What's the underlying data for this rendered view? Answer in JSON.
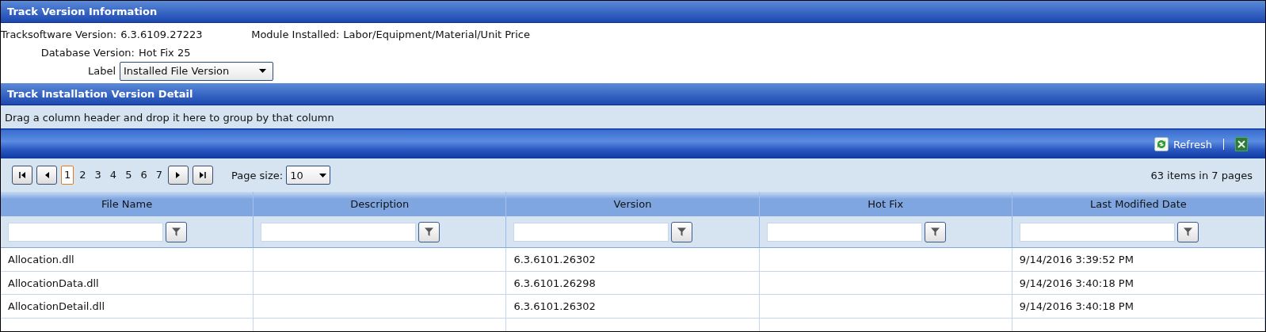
{
  "info_panel": {
    "title": "Track Version Information",
    "software_version": {
      "label": "Tracksoftware Version:",
      "value": "6.3.6109.27223"
    },
    "module": {
      "label": "Module Installed:",
      "value": "Labor/Equipment/Material/Unit Price"
    },
    "database_version": {
      "label": "Database Version:",
      "value": "Hot Fix 25"
    },
    "label_select": {
      "label": "Label",
      "value": "Installed File Version"
    }
  },
  "detail_panel": {
    "title": "Track Installation Version Detail",
    "group_hint": "Drag a column header and drop it here to group by that column",
    "toolbar": {
      "refresh": "Refresh"
    },
    "pager": {
      "pages": [
        {
          "label": "1",
          "selected": true
        },
        {
          "label": "2",
          "selected": false
        },
        {
          "label": "3",
          "selected": false
        },
        {
          "label": "4",
          "selected": false
        },
        {
          "label": "5",
          "selected": false
        },
        {
          "label": "6",
          "selected": false
        },
        {
          "label": "7",
          "selected": false
        }
      ],
      "page_size_label": "Page size:",
      "page_size": "10",
      "summary": "63 items in 7 pages"
    },
    "table": {
      "columns": [
        "File Name",
        "Description",
        "Version",
        "Hot Fix",
        "Last Modified Date"
      ],
      "rows": [
        [
          "Allocation.dll",
          "",
          "6.3.6101.26302",
          "",
          "9/14/2016 3:39:52 PM"
        ],
        [
          "AllocationData.dll",
          "",
          "6.3.6101.26298",
          "",
          "9/14/2016 3:40:18 PM"
        ],
        [
          "AllocationDetail.dll",
          "",
          "6.3.6101.26302",
          "",
          "9/14/2016 3:40:18 PM"
        ]
      ]
    }
  }
}
